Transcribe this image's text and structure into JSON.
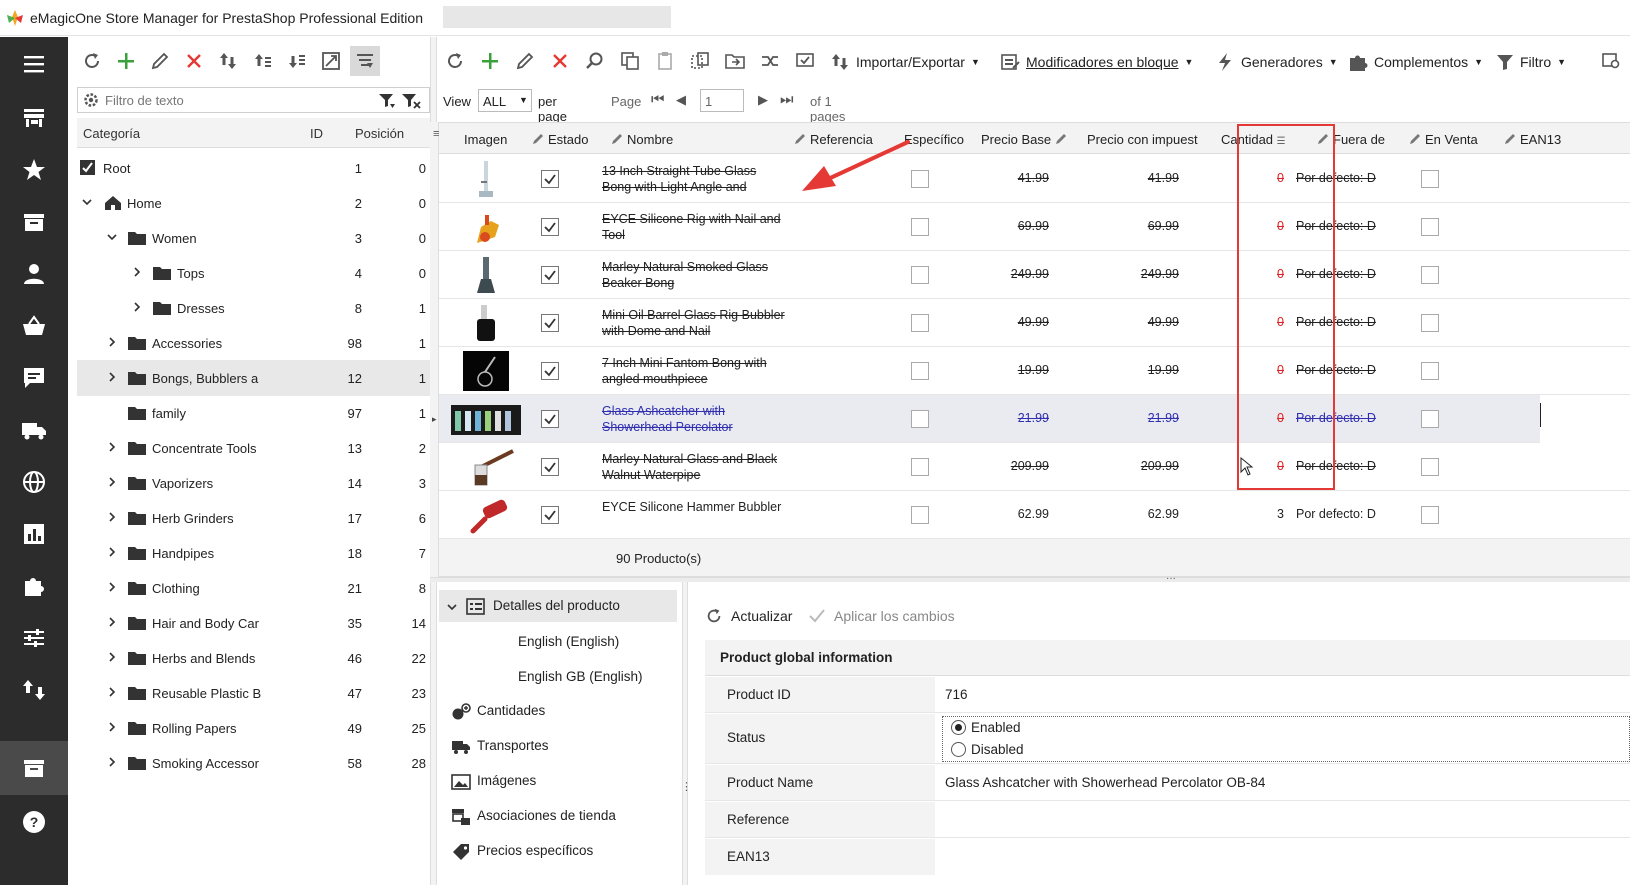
{
  "window": {
    "title": "eMagicOne Store Manager for PrestaShop Professional Edition"
  },
  "left_toolbar": {
    "icons": [
      "refresh-icon",
      "add-icon",
      "edit-icon",
      "delete-icon",
      "move-icon",
      "import-icon",
      "export-icon",
      "expand-icon",
      "filter-columns-icon"
    ]
  },
  "category_filter": {
    "placeholder": "Filtro de texto"
  },
  "category_grid": {
    "headers": {
      "name": "Categoría",
      "id": "ID",
      "position": "Posición"
    },
    "rows": [
      {
        "name": "Root",
        "id": "1",
        "pos": "0"
      },
      {
        "name": "Home",
        "id": "2",
        "pos": "0"
      },
      {
        "name": "Women",
        "id": "3",
        "pos": "0"
      },
      {
        "name": "Tops",
        "id": "4",
        "pos": "0"
      },
      {
        "name": "Dresses",
        "id": "8",
        "pos": "1"
      },
      {
        "name": "Accessories",
        "id": "98",
        "pos": "1"
      },
      {
        "name": "Bongs, Bubblers a",
        "id": "12",
        "pos": "1"
      },
      {
        "name": "family",
        "id": "97",
        "pos": "1"
      },
      {
        "name": "Concentrate Tools",
        "id": "13",
        "pos": "2"
      },
      {
        "name": "Vaporizers",
        "id": "14",
        "pos": "3"
      },
      {
        "name": "Herb Grinders",
        "id": "17",
        "pos": "6"
      },
      {
        "name": "Handpipes",
        "id": "18",
        "pos": "7"
      },
      {
        "name": "Clothing",
        "id": "21",
        "pos": "8"
      },
      {
        "name": "Hair and Body Car",
        "id": "35",
        "pos": "14"
      },
      {
        "name": "Herbs and Blends",
        "id": "46",
        "pos": "22"
      },
      {
        "name": "Reusable Plastic B",
        "id": "47",
        "pos": "23"
      },
      {
        "name": "Rolling Papers",
        "id": "49",
        "pos": "25"
      },
      {
        "name": "Smoking Accessor",
        "id": "58",
        "pos": "28"
      }
    ]
  },
  "main_toolbar": {
    "import_export": "Importar/Exportar",
    "bulk_modifiers": "Modificadores en bloque",
    "generators": "Generadores",
    "addons": "Complementos",
    "filter": "Filtro"
  },
  "pager": {
    "view_label": "View",
    "view_value": "ALL",
    "per_page": "per page",
    "page_label": "Page",
    "page_value": "1",
    "of_pages": "of 1 pages"
  },
  "product_grid": {
    "headers": {
      "image": "Imagen",
      "status": "Estado",
      "name": "Nombre",
      "reference": "Referencia",
      "specific": "Específico",
      "base_price": "Precio Base",
      "price_tax": "Precio con impuest",
      "quantity": "Cantidad",
      "out_of": "Fuera de",
      "on_sale": "En Venta",
      "ean13": "EAN13"
    },
    "rows": [
      {
        "name": "13 Inch Straight Tube Glass Bong with Light Angle and",
        "base": "41.99",
        "tax": "41.99",
        "qty": "0",
        "out": "Por defecto: D",
        "strike": true
      },
      {
        "name": "EYCE Silicone Rig with Nail and Tool",
        "base": "69.99",
        "tax": "69.99",
        "qty": "0",
        "out": "Por defecto: D",
        "strike": true
      },
      {
        "name": "Marley Natural Smoked Glass Beaker Bong",
        "base": "249.99",
        "tax": "249.99",
        "qty": "0",
        "out": "Por defecto: D",
        "strike": true
      },
      {
        "name": "Mini Oil Barrel Glass Rig Bubbler with Dome and Nail",
        "base": "49.99",
        "tax": "49.99",
        "qty": "0",
        "out": "Por defecto: D",
        "strike": true
      },
      {
        "name": "7 Inch Mini Fantom Bong with angled mouthpiece",
        "base": "19.99",
        "tax": "19.99",
        "qty": "0",
        "out": "Por defecto: D",
        "strike": true
      },
      {
        "name": "Glass Ashcatcher with Showerhead Percolator",
        "base": "21.99",
        "tax": "21.99",
        "qty": "0",
        "out": "Por defecto: D",
        "strike": true
      },
      {
        "name": "Marley Natural Glass and Black Walnut Waterpipe",
        "base": "209.99",
        "tax": "209.99",
        "qty": "0",
        "out": "Por defecto: D",
        "strike": true
      },
      {
        "name": "EYCE Silicone Hammer Bubbler",
        "base": "62.99",
        "tax": "62.99",
        "qty": "3",
        "out": "Por defecto: D",
        "strike": false
      }
    ],
    "footer": "90 Producto(s)"
  },
  "details_tree": {
    "root": "Detalles del producto",
    "items": [
      "English (English)",
      "English GB (English)",
      "Cantidades",
      "Transportes",
      "Imágenes",
      "Asociaciones de tienda",
      "Precios específicos"
    ]
  },
  "details_toolbar": {
    "refresh": "Actualizar",
    "apply": "Aplicar los cambios"
  },
  "details": {
    "section": "Product global information",
    "product_id_label": "Product ID",
    "product_id": "716",
    "status_label": "Status",
    "enabled": "Enabled",
    "disabled": "Disabled",
    "name_label": "Product Name",
    "name_value": "Glass Ashcatcher with Showerhead Percolator OB-84",
    "reference_label": "Reference",
    "ean13_label": "EAN13"
  },
  "colors": {
    "accent_red": "#e53935",
    "sidebar": "#2c2c2c",
    "strike_blue": "#2f2fb0"
  }
}
